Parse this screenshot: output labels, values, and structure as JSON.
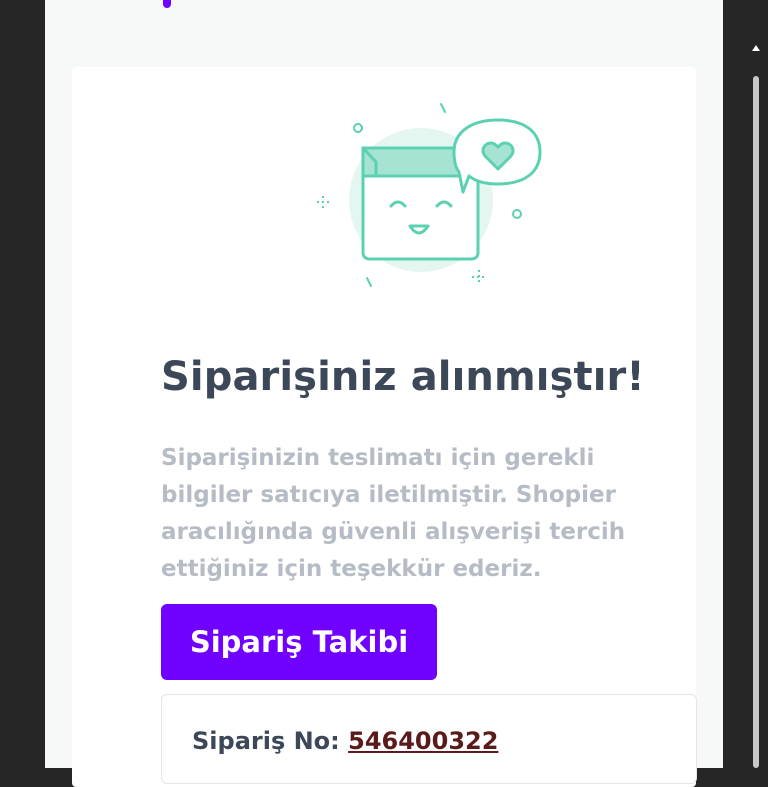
{
  "success": {
    "title": "Siparişiniz alınmıştır!",
    "description": "Siparişinizin teslimatı için gerekli bilgiler satıcıya iletilmiştir. Shopier aracılığında güvenli alışverişi tercih ettiğiniz için teşekkür ederiz.",
    "track_button": "Sipariş Takibi"
  },
  "order": {
    "label": "Sipariş No:",
    "number": "546400322"
  },
  "colors": {
    "accent": "#7000ff",
    "illustration": "#5cd1b2",
    "illustration_fill": "#a6e3d3",
    "title": "#3c4858",
    "muted": "#b6bcc5"
  },
  "icons": [
    "happy-box-icon",
    "heart-speech-bubble-icon",
    "sparkle-icon",
    "scroll-up-icon"
  ]
}
